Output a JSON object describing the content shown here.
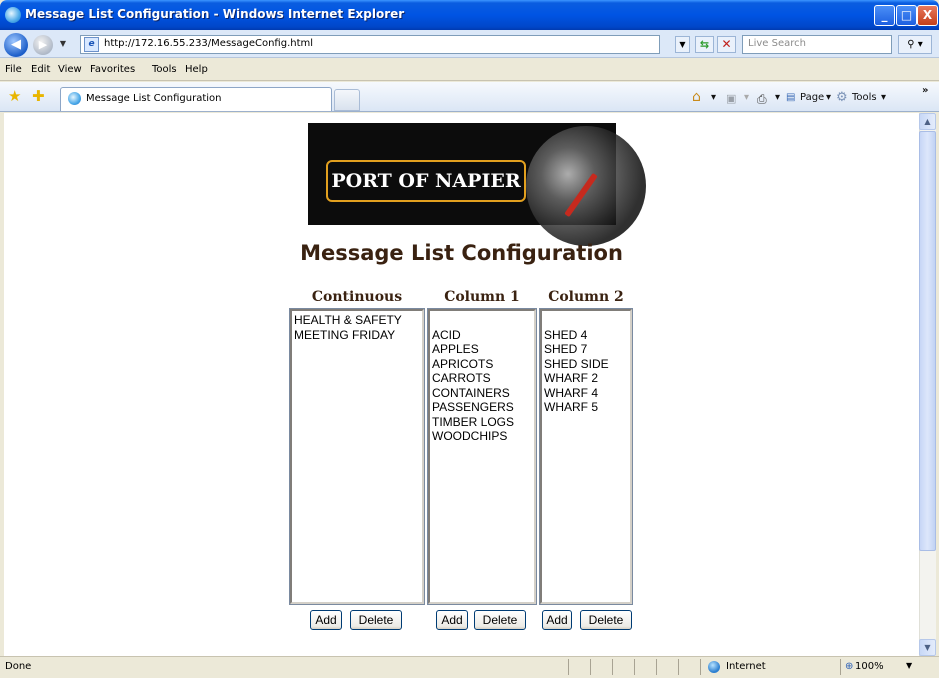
{
  "window": {
    "title": "Message List Configuration - Windows Internet Explorer",
    "buttons": {
      "minimize": "_",
      "maximize": "□",
      "close": "X"
    }
  },
  "addressbar": {
    "url": "http://172.16.55.233/MessageConfig.html",
    "search_placeholder": "Live Search",
    "back_glyph": "◀",
    "forward_glyph": "▶"
  },
  "menubar": {
    "items": [
      "File",
      "Edit",
      "View",
      "Favorites",
      "Tools",
      "Help"
    ]
  },
  "tab": {
    "label": "Message List Configuration"
  },
  "commandbar": {
    "page_label": "Page",
    "tools_label": "Tools",
    "overflow": "»"
  },
  "page": {
    "logo_text": "PORT OF NAPIER",
    "title": "Message List Configuration",
    "columns": [
      {
        "header": "Continuous",
        "items": [
          "HEALTH & SAFETY",
          "MEETING FRIDAY"
        ],
        "add_label": "Add",
        "delete_label": "Delete"
      },
      {
        "header": "Column 1",
        "items": [
          "",
          "ACID",
          "APPLES",
          "APRICOTS",
          "CARROTS",
          "CONTAINERS",
          "PASSENGERS",
          "TIMBER LOGS",
          "WOODCHIPS"
        ],
        "add_label": "Add",
        "delete_label": "Delete"
      },
      {
        "header": "Column 2",
        "items": [
          "",
          "SHED 4",
          "SHED 7",
          "SHED SIDE",
          "WHARF 2",
          "WHARF 4",
          "WHARF 5"
        ],
        "add_label": "Add",
        "delete_label": "Delete"
      }
    ]
  },
  "statusbar": {
    "status": "Done",
    "zone": "Internet",
    "zoom": "100%"
  },
  "colors": {
    "heading": "#3a2211",
    "titlebar": "#0054e3",
    "logo_border": "#e2a01f"
  }
}
